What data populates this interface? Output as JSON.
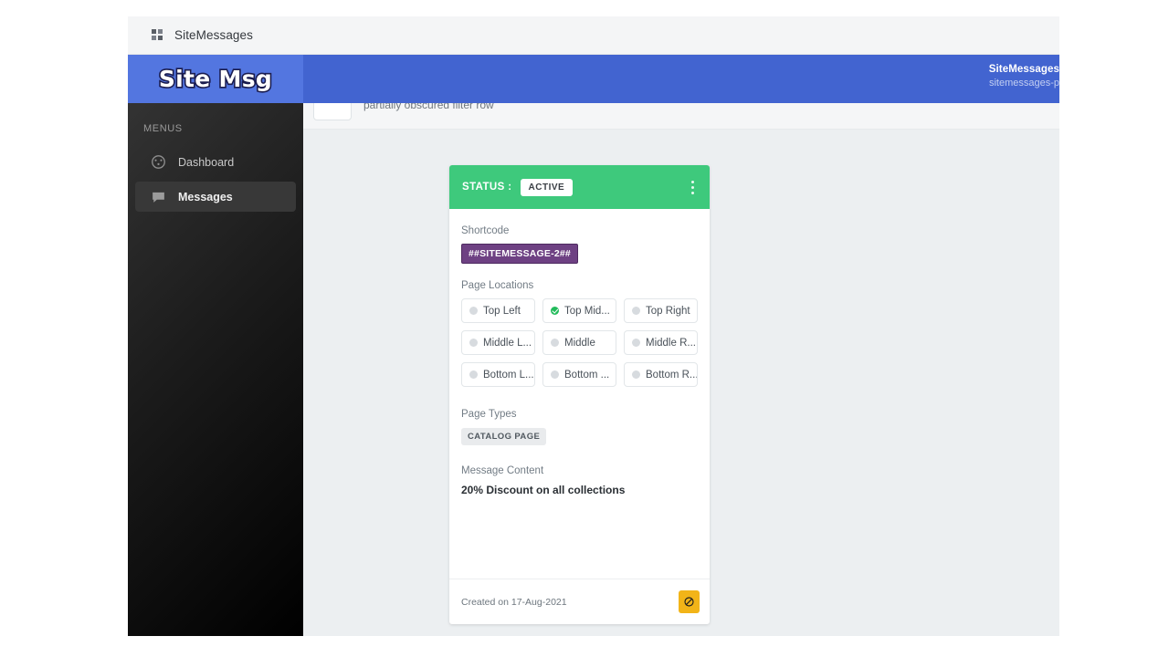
{
  "browser_bar": {
    "app_icon": "apps-grid-icon",
    "title": "SiteMessages"
  },
  "header": {
    "logo_text": "Site Msg",
    "account_name": "SiteMessages",
    "account_sub": "sitemessages-p",
    "bg_color": "#4264d0",
    "logo_panel_color": "#5376e0"
  },
  "sidebar": {
    "section_label": "MENUS",
    "items": [
      {
        "label": "Dashboard",
        "icon": "speedometer-icon",
        "active": false
      },
      {
        "label": "Messages",
        "icon": "chat-bubble-icon",
        "active": true
      }
    ]
  },
  "toolbar": {
    "hidden_text": "partially obscured filter row"
  },
  "card": {
    "status_label": "STATUS :",
    "status_value": "ACTIVE",
    "status_color": "#3ec97c",
    "menu_icon": "kebab-menu-icon",
    "shortcode_label": "Shortcode",
    "shortcode_value": "##SITEMESSAGE-2##",
    "shortcode_color": "#6e4183",
    "page_locations_label": "Page Locations",
    "page_locations": [
      {
        "label": "Top Left",
        "selected": false
      },
      {
        "label": "Top Mid...",
        "selected": true
      },
      {
        "label": "Top Right",
        "selected": false
      },
      {
        "label": "Middle L...",
        "selected": false
      },
      {
        "label": "Middle",
        "selected": false
      },
      {
        "label": "Middle R...",
        "selected": false
      },
      {
        "label": "Bottom L...",
        "selected": false
      },
      {
        "label": "Bottom ...",
        "selected": false
      },
      {
        "label": "Bottom R...",
        "selected": false
      }
    ],
    "page_types_label": "Page Types",
    "page_types": [
      "CATALOG PAGE"
    ],
    "message_content_label": "Message Content",
    "message_content_value": "20% Discount on all collections",
    "created_text": "Created on 17-Aug-2021",
    "disable_icon": "prohibition-icon",
    "disable_color": "#f2b418"
  }
}
